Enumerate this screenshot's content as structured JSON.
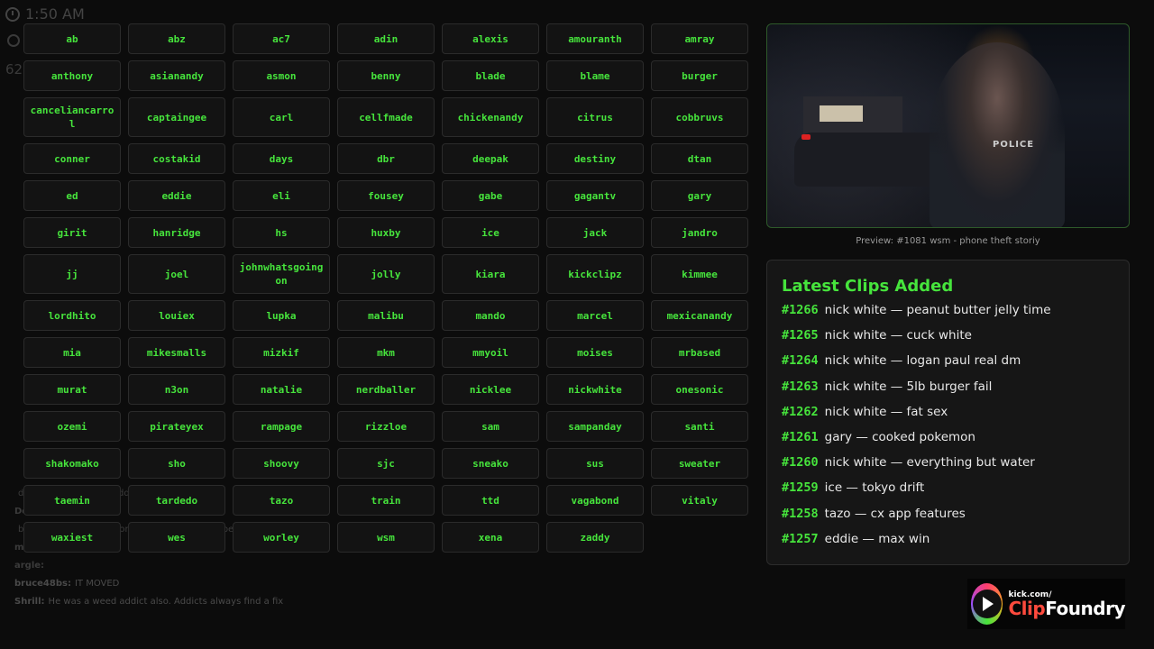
{
  "overlay": {
    "time": "1:50 AM",
    "count_partial": "62,",
    "chat": [
      {
        "user": "",
        "text": "dudes a fan of weed addict now"
      },
      {
        "user": "De",
        "text": ""
      },
      {
        "user": "",
        "text": "be reader to be ateep on kick the guy was super"
      },
      {
        "user": "m",
        "text": ""
      },
      {
        "user": "argle:",
        "text": ""
      },
      {
        "user": "bruce48bs:",
        "text": "IT MOVED"
      },
      {
        "user": "Shrill:",
        "text": "He was a weed addict also. Addicts always find a fix"
      }
    ]
  },
  "buttons": [
    "ab",
    "abz",
    "ac7",
    "adin",
    "alexis",
    "amouranth",
    "amray",
    "anthony",
    "asianandy",
    "asmon",
    "benny",
    "blade",
    "blame",
    "burger",
    "canceliancarrol",
    "captaingee",
    "carl",
    "cellfmade",
    "chickenandy",
    "citrus",
    "cobbruvs",
    "conner",
    "costakid",
    "days",
    "dbr",
    "deepak",
    "destiny",
    "dtan",
    "ed",
    "eddie",
    "eli",
    "fousey",
    "gabe",
    "gagantv",
    "gary",
    "girit",
    "hanridge",
    "hs",
    "huxby",
    "ice",
    "jack",
    "jandro",
    "jj",
    "joel",
    "johnwhatsgoingon",
    "jolly",
    "kiara",
    "kickclipz",
    "kimmee",
    "lordhito",
    "louiex",
    "lupka",
    "malibu",
    "mando",
    "marcel",
    "mexicanandy",
    "mia",
    "mikesmalls",
    "mizkif",
    "mkm",
    "mmyoil",
    "moises",
    "mrbased",
    "murat",
    "n3on",
    "natalie",
    "nerdballer",
    "nicklee",
    "nickwhite",
    "onesonic",
    "ozemi",
    "pirateyex",
    "rampage",
    "rizzloe",
    "sam",
    "sampanday",
    "santi",
    "shakomako",
    "sho",
    "shoovy",
    "sjc",
    "sneako",
    "sus",
    "sweater",
    "taemin",
    "tardedo",
    "tazo",
    "train",
    "ttd",
    "vagabond",
    "vitaly",
    "waxiest",
    "wes",
    "worley",
    "wsm",
    "xena",
    "zaddy"
  ],
  "preview": {
    "caption": "Preview: #1081 wsm - phone theft storiy",
    "badge": "POLICE"
  },
  "latest": {
    "title": "Latest Clips Added",
    "clips": [
      {
        "num": "#1266",
        "text": "nick white — peanut butter jelly time"
      },
      {
        "num": "#1265",
        "text": "nick white — cuck white"
      },
      {
        "num": "#1264",
        "text": "nick white — logan paul real dm"
      },
      {
        "num": "#1263",
        "text": "nick white — 5lb burger fail"
      },
      {
        "num": "#1262",
        "text": "nick white — fat sex"
      },
      {
        "num": "#1261",
        "text": "gary — cooked pokemon"
      },
      {
        "num": "#1260",
        "text": "nick white — everything but water"
      },
      {
        "num": "#1259",
        "text": "ice — tokyo drift"
      },
      {
        "num": "#1258",
        "text": "tazo — cx app features"
      },
      {
        "num": "#1257",
        "text": "eddie — max win"
      }
    ]
  },
  "logo": {
    "small": "kick.com/",
    "clip": "Clip",
    "foundry": "Foundry"
  },
  "colors": {
    "accent": "#46e43c",
    "background": "#0c0c0c"
  }
}
